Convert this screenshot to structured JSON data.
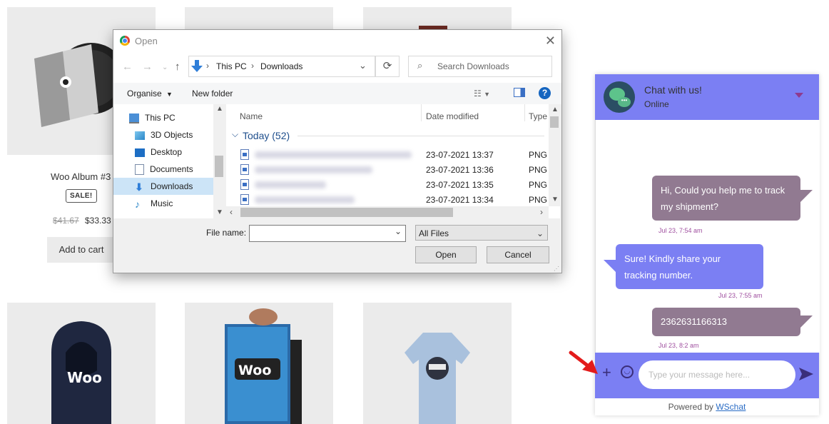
{
  "shop": {
    "product1": {
      "title": "Woo Album #3",
      "badge": "SALE!",
      "old_price": "$41.67",
      "price": "$33.33",
      "button": "Add to cart"
    }
  },
  "dialog": {
    "title": "Open",
    "breadcrumb": [
      "This PC",
      "Downloads"
    ],
    "search_placeholder": "Search Downloads",
    "toolbar": {
      "organise": "Organise",
      "new_folder": "New folder"
    },
    "tree": [
      "This PC",
      "3D Objects",
      "Desktop",
      "Documents",
      "Downloads",
      "Music"
    ],
    "columns": {
      "name": "Name",
      "date": "Date modified",
      "type": "Type"
    },
    "group": "Today (52)",
    "files": [
      {
        "date": "23-07-2021 13:37",
        "type": "PNG"
      },
      {
        "date": "23-07-2021 13:36",
        "type": "PNG"
      },
      {
        "date": "23-07-2021 13:35",
        "type": "PNG"
      },
      {
        "date": "23-07-2021 13:34",
        "type": "PNG"
      }
    ],
    "file_name_label": "File name:",
    "file_name_value": "",
    "filter": "All Files",
    "open": "Open",
    "cancel": "Cancel"
  },
  "chat": {
    "title": "Chat with us!",
    "status": "Online",
    "messages": [
      {
        "text": "Hi, Could you help me to track my shipment?",
        "time": "Jul 23, 7:54 am",
        "dir": "out"
      },
      {
        "text": "Sure! Kindly share your tracking number.",
        "time": "Jul 23, 7:55 am",
        "dir": "in"
      },
      {
        "text": "2362631166313",
        "time": "Jul 23, 8:2 am",
        "dir": "out"
      }
    ],
    "input_placeholder": "Type your message here...",
    "powered_prefix": "Powered by",
    "powered_link": "WSchat"
  },
  "colors": {
    "chat_accent": "#7b7ff3",
    "outgoing_bubble": "#917a91",
    "annotation_arrow": "#e31b1b"
  }
}
